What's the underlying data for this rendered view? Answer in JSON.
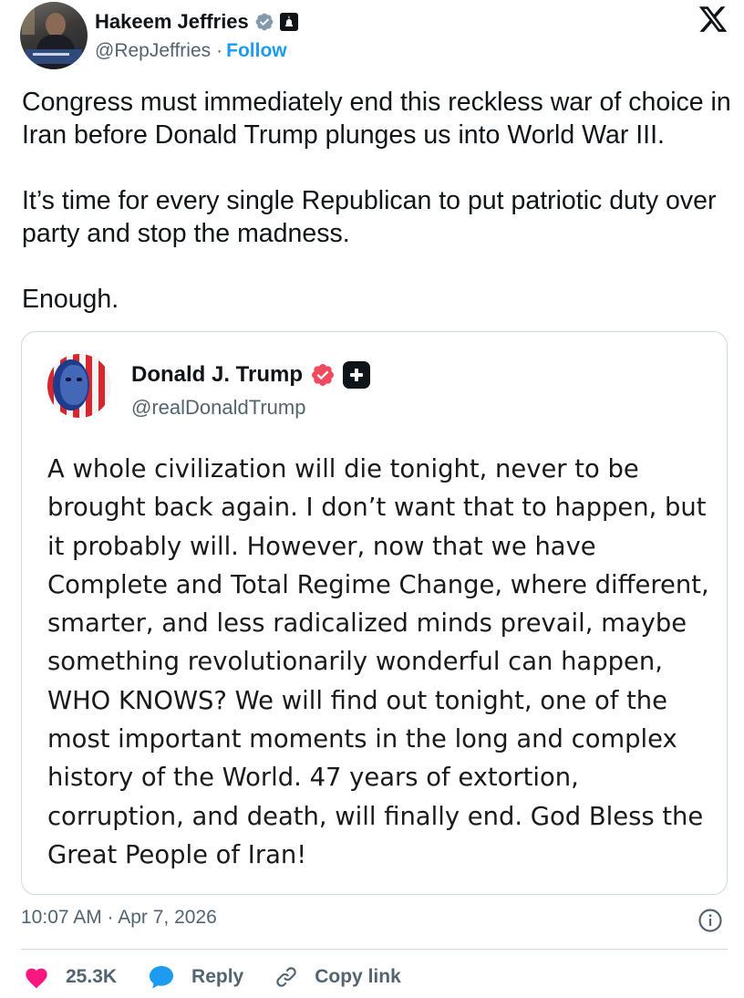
{
  "author": {
    "name": "Hakeem Jeffries",
    "handle": "@RepJeffries",
    "separator": "·",
    "follow_label": "Follow",
    "verified_icon": "verified-gray-badge-icon",
    "affiliation_icon": "government-capitol-icon"
  },
  "platform_logo": "x-logo",
  "tweet": {
    "paragraphs": [
      "Congress must immediately end this reckless war of choice in Iran before Donald Trump plunges us into World War III.",
      "It’s time for every single Republican to put patriotic duty over party and stop the madness.",
      "Enough."
    ]
  },
  "quoted_post": {
    "name": "Donald J. Trump",
    "handle": "@realDonaldTrump",
    "verified_icon": "verified-red-badge-icon",
    "platform_icon": "truth-social-plus-icon",
    "text": "A whole civilization will die tonight, never to be brought back again. I don’t want that to happen, but it probably will. However, now that we have Complete and Total Regime Change, where different, smarter, and less radicalized minds prevail, maybe something revolutionarily wonderful can happen, WHO KNOWS? We will find out tonight, one of the most important moments in the long and complex history of the World. 47 years of extortion, corruption, and death, will finally end. God Bless the Great People of Iran!"
  },
  "meta": {
    "timestamp": "10:07 AM · Apr 7, 2026"
  },
  "actions": {
    "likes": "25.3K",
    "reply_label": "Reply",
    "copy_link_label": "Copy link"
  },
  "colors": {
    "accent": "#1d9bf0",
    "like": "#f91880",
    "text": "#0f1419",
    "secondary": "#536471",
    "border": "#cfd9de",
    "verified_red": "#ef4a5e"
  }
}
